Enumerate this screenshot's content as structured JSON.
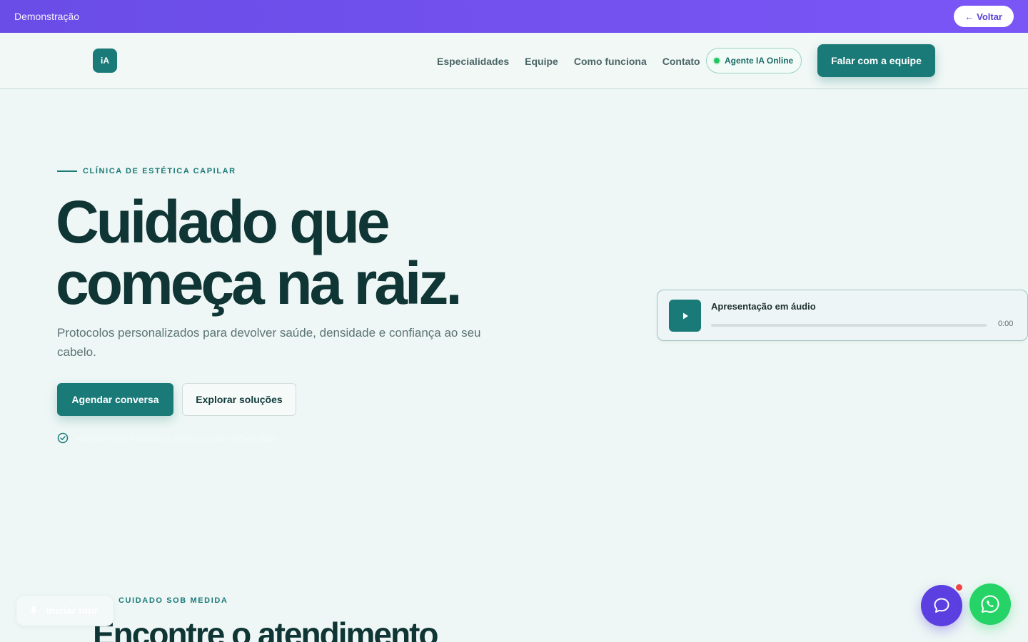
{
  "demo_bar": {
    "title": "Demonstração",
    "back_label": "← Voltar"
  },
  "header": {
    "logo_text": "iA",
    "nav": [
      "Especialidades",
      "Equipe",
      "Como funciona",
      "Contato"
    ],
    "agent_status": "Agente IA Online",
    "cta_label": "Falar com a equipe"
  },
  "hero": {
    "eyebrow": "CLÍNICA DE ESTÉTICA CAPILAR",
    "title_line1": "Cuidado que",
    "title_line2": "começa na raiz.",
    "subtitle": "Protocolos personalizados para devolver saúde, densidade e confiança ao seu cabelo.",
    "primary_button": "Agendar conversa",
    "secondary_button": "Explorar soluções",
    "note": "Atendimento humano e resposta pelo WhatsApp"
  },
  "audio": {
    "title": "Apresentação em áudio",
    "time": "0:00",
    "progress": 0
  },
  "section2": {
    "eyebrow": "CUIDADO SOB MEDIDA",
    "title": "Encontre o atendimento"
  },
  "tour": {
    "label": "Iniciar tour",
    "icon": "microphone-icon"
  },
  "floating": {
    "chat_icon": "chat-bubble-icon",
    "whatsapp_icon": "whatsapp-icon"
  },
  "colors": {
    "accent": "#1a7a78",
    "purple": "#5b3fe0",
    "whatsapp": "#25d366",
    "background": "#eef7f5",
    "heading": "#0f3535"
  }
}
